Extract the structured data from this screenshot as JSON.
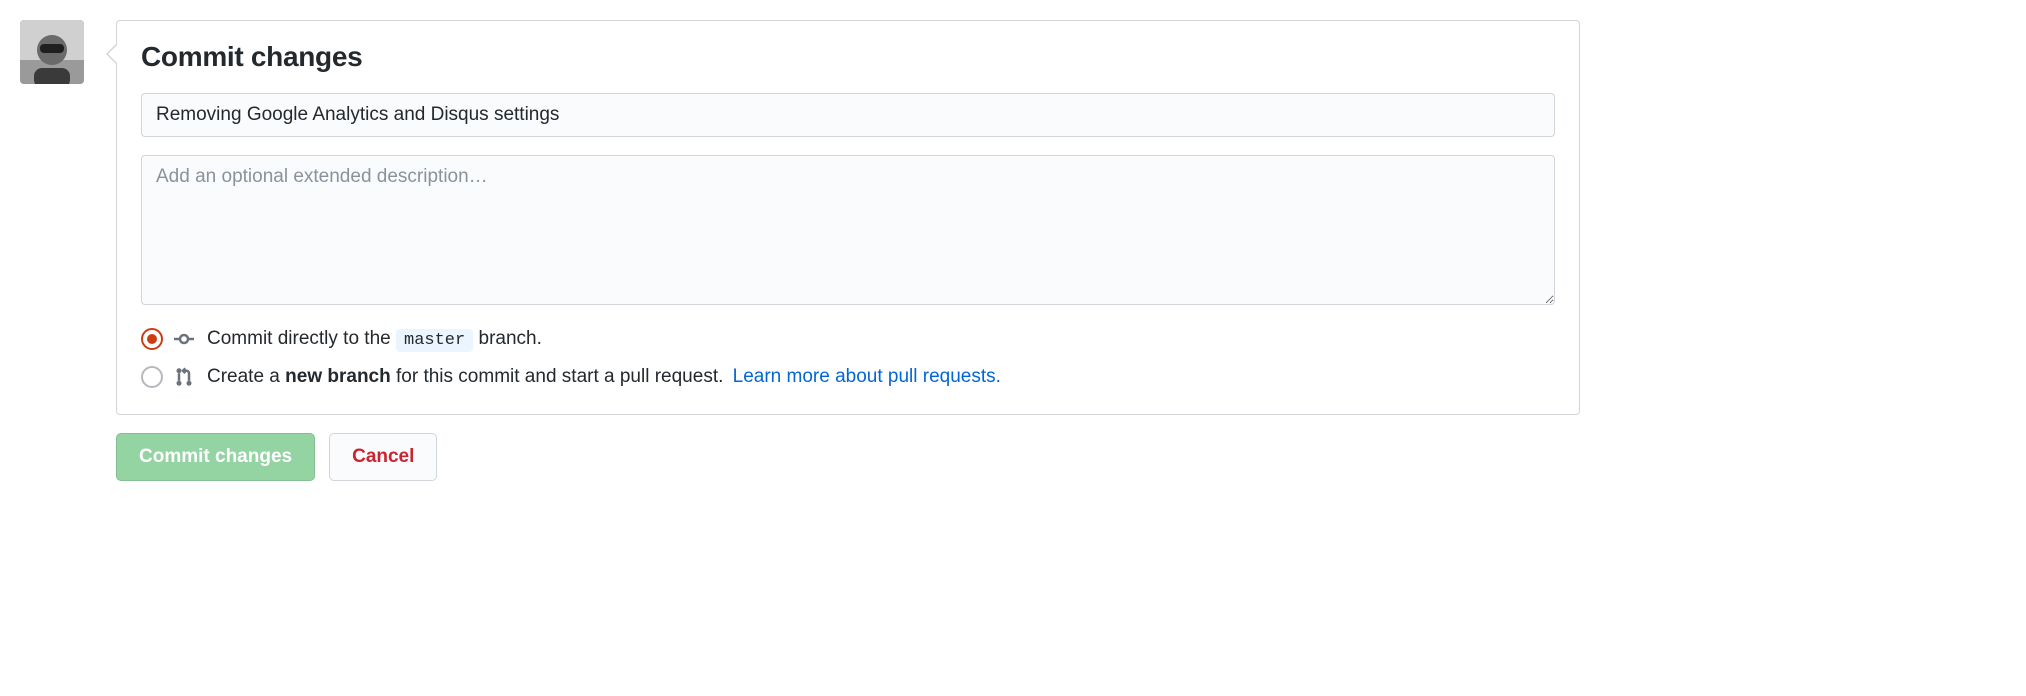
{
  "header": {
    "title": "Commit changes"
  },
  "form": {
    "summary_value": "Removing Google Analytics and Disqus settings",
    "description_placeholder": "Add an optional extended description…"
  },
  "options": {
    "commit_direct_pre": "Commit directly to the ",
    "commit_direct_branch": "master",
    "commit_direct_post": " branch.",
    "new_branch_pre": "Create a ",
    "new_branch_strong": "new branch",
    "new_branch_post": " for this commit and start a pull request. ",
    "learn_more": "Learn more about pull requests."
  },
  "buttons": {
    "commit": "Commit changes",
    "cancel": "Cancel"
  }
}
